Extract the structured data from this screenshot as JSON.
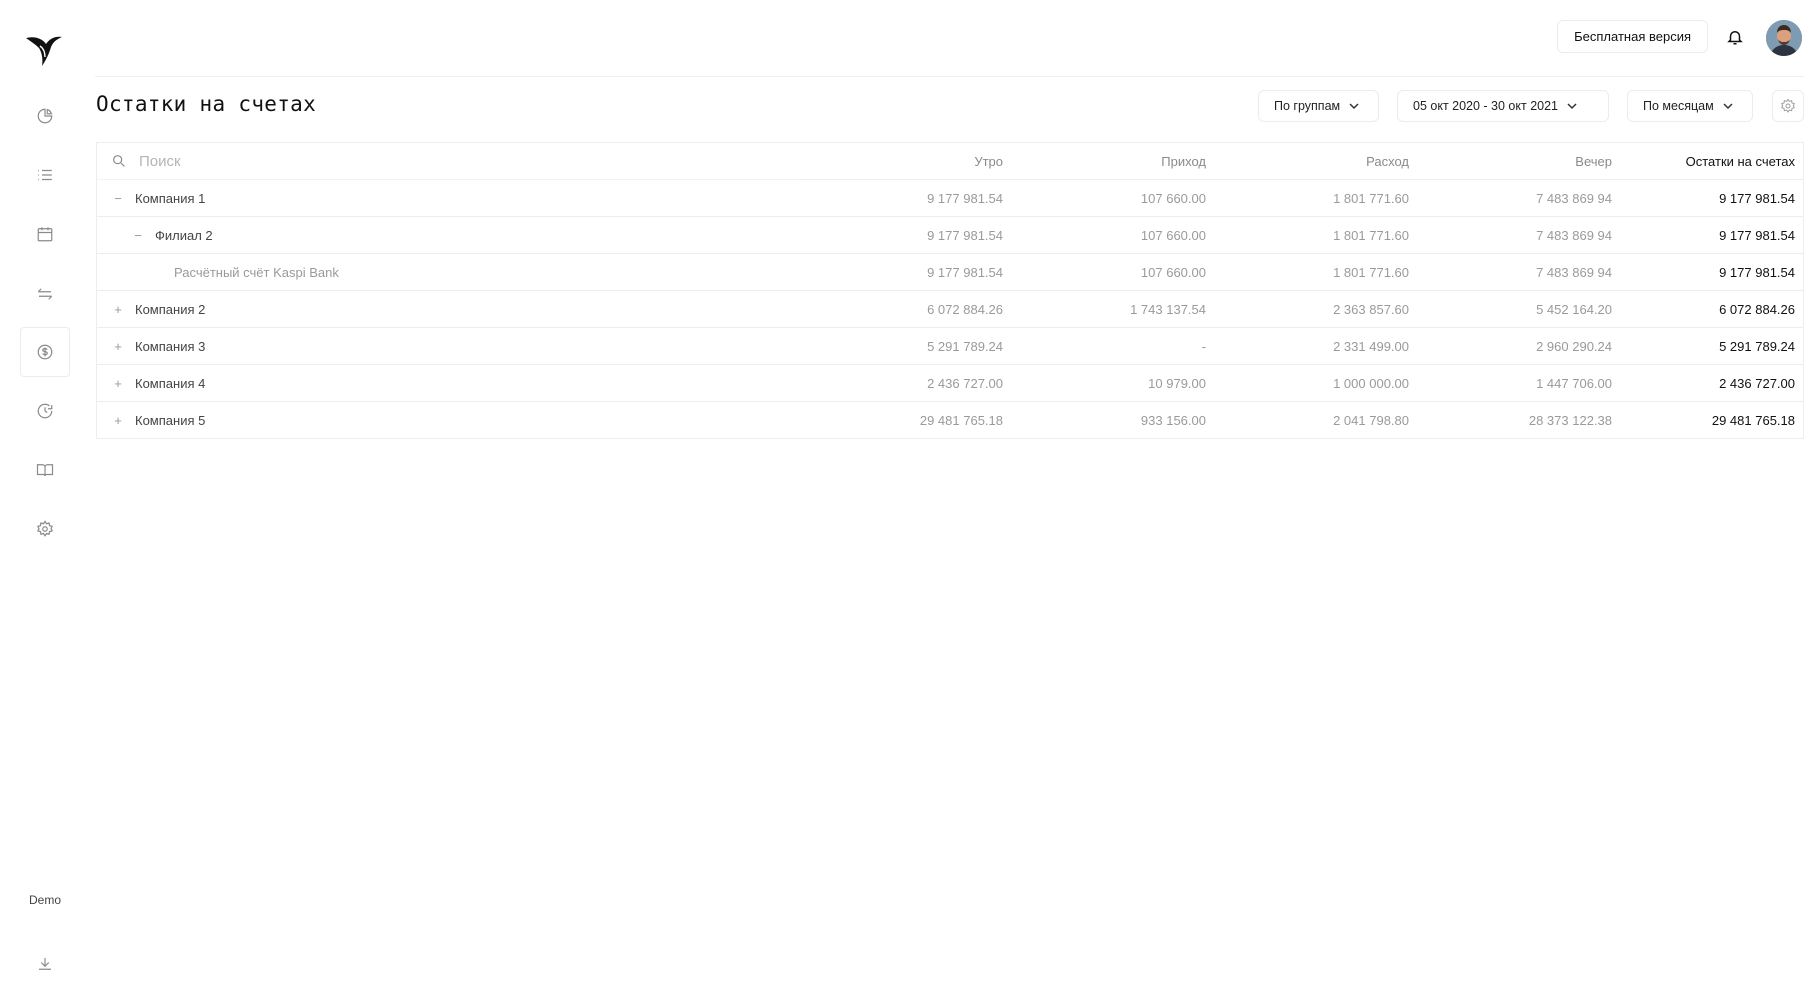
{
  "header": {
    "free_version_label": "Бесплатная версия"
  },
  "sidebar": {
    "demo_label": "Demo"
  },
  "page": {
    "title": "Остатки на счетах"
  },
  "filters": {
    "grouping": "По группам",
    "date_range": "05 окт 2020 - 30 окт 2021",
    "period": "По месяцам"
  },
  "table": {
    "search_placeholder": "Поиск",
    "columns": [
      "Утро",
      "Приход",
      "Расход",
      "Вечер",
      "Остатки на счетах"
    ],
    "rows": [
      {
        "name": "Компания 1",
        "toggle": "−",
        "values": [
          "9 177 981.54",
          "107 660.00",
          "1 801 771.60",
          "7 483 869 94",
          "9 177 981.54"
        ]
      },
      {
        "name": "Филиал 2",
        "toggle": "−",
        "values": [
          "9 177 981.54",
          "107 660.00",
          "1 801 771.60",
          "7 483 869 94",
          "9 177 981.54"
        ]
      },
      {
        "name": "Расчётный счёт Kaspi Bank",
        "toggle": "",
        "values": [
          "9 177 981.54",
          "107 660.00",
          "1 801 771.60",
          "7 483 869 94",
          "9 177 981.54"
        ]
      },
      {
        "name": "Компания 2",
        "toggle": "+",
        "values": [
          "6 072 884.26",
          "1 743 137.54",
          "2 363 857.60",
          "5 452 164.20",
          "6 072 884.26"
        ]
      },
      {
        "name": "Компания 3",
        "toggle": "+",
        "values": [
          "5 291 789.24",
          "-",
          "2 331 499.00",
          "2 960 290.24",
          "5 291 789.24"
        ]
      },
      {
        "name": "Компания 4",
        "toggle": "+",
        "values": [
          "2 436 727.00",
          "10 979.00",
          "1 000 000.00",
          "1 447 706.00",
          "2 436 727.00"
        ]
      },
      {
        "name": "Компания 5",
        "toggle": "+",
        "values": [
          "29 481 765.18",
          "933 156.00",
          "2 041 798.80",
          "28 373 122.38",
          "29 481 765.18"
        ]
      }
    ]
  }
}
